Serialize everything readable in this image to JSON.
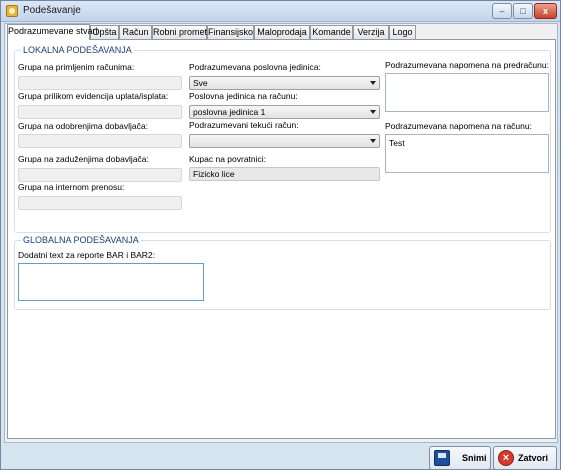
{
  "window": {
    "title": "Podešavanje"
  },
  "tabs": [
    "Podrazumevane stvari",
    "Opšta",
    "Račun",
    "Robni promet",
    "Finansijsko",
    "Maloprodaja",
    "Komande",
    "Verzija",
    "Logo"
  ],
  "local": {
    "title": "LOKALNA PODEŠAVANJA",
    "grupa_primljeni": "Grupa na primljenim računima:",
    "grupa_uplata": "Grupa prilikom evidencija uplata/isplata:",
    "grupa_odobrenja": "Grupa na odobrenjima dobavljača:",
    "grupa_zaduzenja": "Grupa na zaduženjima dobavljača:",
    "grupa_interni": "Grupa na internom prenosu:",
    "poslovna_jedinica_label": "Podrazumevana poslovna jedinica:",
    "poslovna_jedinica_value": "Sve",
    "pj_racun_label": "Poslovna jedinica na računu:",
    "pj_racun_value": "poslovna jedinica 1",
    "tekuci_label": "Podrazumevani tekući račun:",
    "tekuci_value": "",
    "kupac_label": "Kupac na povratnici:",
    "kupac_value": "Fizicko lice",
    "napomena_predracun_label": "Podrazumevana napomena na predračunu:",
    "napomena_predracun_value": "",
    "napomena_racun_label": "Podrazumevana napomena na računu:",
    "napomena_racun_value": "Test"
  },
  "global": {
    "title": "GLOBALNA PODEŠAVANJA",
    "text_label": "Dodatni text za reporte BAR i BAR2:",
    "text_value": ""
  },
  "buttons": {
    "save": "Snimi",
    "close": "Zatvori"
  },
  "titlebar_buttons": {
    "minimize": "–",
    "maximize": "□",
    "close": "x"
  }
}
